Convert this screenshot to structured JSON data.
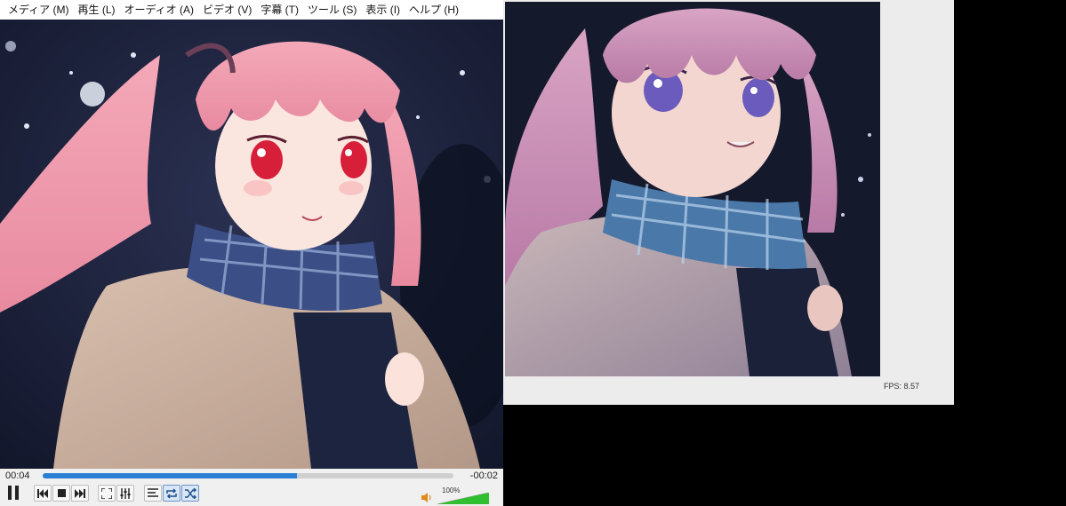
{
  "menu": {
    "items": [
      {
        "label": "メディア (M)"
      },
      {
        "label": "再生 (L)"
      },
      {
        "label": "オーディオ (A)"
      },
      {
        "label": "ビデオ (V)"
      },
      {
        "label": "字幕 (T)"
      },
      {
        "label": "ツール (S)"
      },
      {
        "label": "表示 (I)"
      },
      {
        "label": "ヘルプ (H)"
      }
    ]
  },
  "playback": {
    "elapsed": "00:04",
    "remaining": "-00:02",
    "progress_fraction": 0.62,
    "accent_color": "#2a7fd4"
  },
  "volume": {
    "label": "100%",
    "level_fraction": 1.0,
    "color": "#2fbf2f"
  },
  "output": {
    "fps_text": "FPS: 8.57"
  },
  "icons": {
    "play": "pause-icon",
    "prev": "previous-icon",
    "stop": "stop-icon",
    "next": "next-icon",
    "fullscreen": "fullscreen-icon",
    "effects": "equalizer-icon",
    "playlist": "playlist-icon",
    "loop": "loop-icon",
    "shuffle": "shuffle-icon",
    "volume": "speaker-icon"
  }
}
